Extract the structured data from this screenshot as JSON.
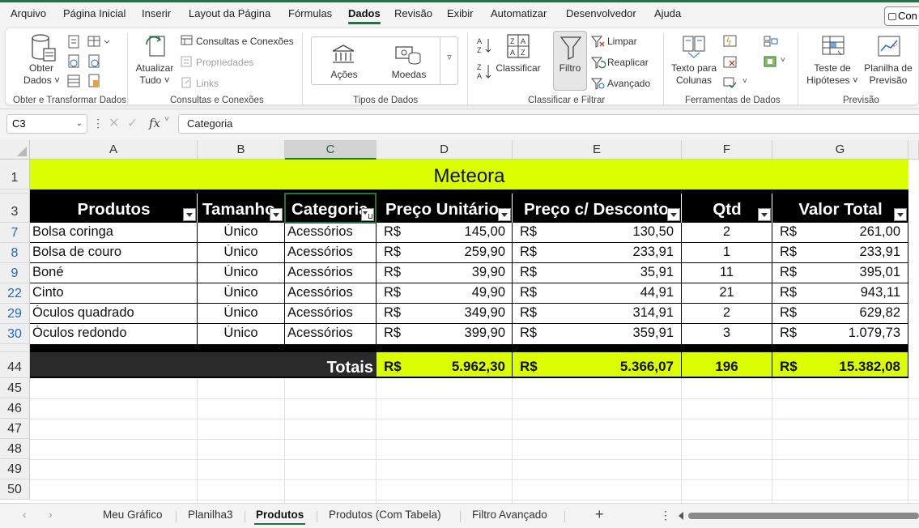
{
  "menu": {
    "items": [
      "Arquivo",
      "Página Inicial",
      "Inserir",
      "Layout da Página",
      "Fórmulas",
      "Dados",
      "Revisão",
      "Exibir",
      "Automatizar",
      "Desenvolvedor",
      "Ajuda"
    ],
    "active": "Dados",
    "comments_label": "Con"
  },
  "ribbon": {
    "get_data_l1": "Obter",
    "get_data_l2": "Dados ˅",
    "refresh_l1": "Atualizar",
    "refresh_l2": "Tudo ˅",
    "queries": "Consultas e Conexões",
    "properties": "Propriedades",
    "links": "Links",
    "stocks": "Ações",
    "currencies": "Moedas",
    "sort": "Classificar",
    "filter": "Filtro",
    "clear": "Limpar",
    "reapply": "Reaplicar",
    "advanced": "Avançado",
    "text_to_cols_l1": "Texto para",
    "text_to_cols_l2": "Colunas",
    "whatif_l1": "Teste de",
    "whatif_l2": "Hipóteses ˅",
    "forecast_l1": "Planilha de",
    "forecast_l2": "Previsão",
    "groups": {
      "get_transform": "Obter e Transformar Dados",
      "queries_conn": "Consultas e Conexões",
      "data_types": "Tipos de Dados",
      "sort_filter": "Classificar e Filtrar",
      "data_tools": "Ferramentas de Dados",
      "forecast": "Previsão"
    }
  },
  "formula_bar": {
    "cell_ref": "C3",
    "fx": "fx",
    "content": "Categoria"
  },
  "grid": {
    "columns": [
      "A",
      "B",
      "C",
      "D",
      "E",
      "F",
      "G"
    ],
    "selected_column": "C",
    "row_numbers": [
      "1",
      "3",
      "7",
      "8",
      "9",
      "22",
      "29",
      "30",
      "44",
      "45",
      "46",
      "47",
      "48",
      "49",
      "50"
    ],
    "title": "Meteora",
    "headers": [
      "Produtos",
      "Tamanho",
      "Categoria",
      "Preço Unitário",
      "Preço c/ Desconto",
      "Qtd",
      "Valor Total"
    ],
    "currency": "R$",
    "rows": [
      {
        "produto": "Bolsa coringa",
        "tamanho": "Único",
        "categoria": "Acessórios",
        "preco": "145,00",
        "desconto": "130,50",
        "qtd": "2",
        "total": "261,00"
      },
      {
        "produto": "Bolsa de couro",
        "tamanho": "Único",
        "categoria": "Acessórios",
        "preco": "259,90",
        "desconto": "233,91",
        "qtd": "1",
        "total": "233,91"
      },
      {
        "produto": "Boné",
        "tamanho": "Único",
        "categoria": "Acessórios",
        "preco": "39,90",
        "desconto": "35,91",
        "qtd": "11",
        "total": "395,01"
      },
      {
        "produto": "Cinto",
        "tamanho": "Único",
        "categoria": "Acessórios",
        "preco": "49,90",
        "desconto": "44,91",
        "qtd": "21",
        "total": "943,11"
      },
      {
        "produto": "Óculos quadrado",
        "tamanho": "Único",
        "categoria": "Acessórios",
        "preco": "349,90",
        "desconto": "314,91",
        "qtd": "2",
        "total": "629,82"
      },
      {
        "produto": "Óculos redondo",
        "tamanho": "Único",
        "categoria": "Acessórios",
        "preco": "399,90",
        "desconto": "359,91",
        "qtd": "3",
        "total": "1.079,73"
      }
    ],
    "totals": {
      "label": "Totais",
      "preco": "5.962,30",
      "desconto": "5.366,07",
      "qtd": "196",
      "total": "15.382,08"
    }
  },
  "sheets": {
    "tabs": [
      "Meu Gráfico",
      "Planilha3",
      "Produtos",
      "Produtos (Com Tabela)",
      "Filtro Avançado"
    ],
    "active": "Produtos",
    "add": "+",
    "more": "⋮"
  },
  "colors": {
    "accent": "#217346",
    "title_fill": "#dbff00",
    "header_fill": "#000000",
    "row_number": "#1b6bc0"
  }
}
